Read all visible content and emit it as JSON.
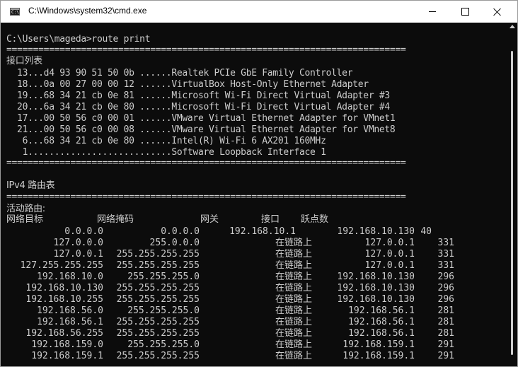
{
  "window": {
    "title": "C:\\Windows\\system32\\cmd.exe",
    "icon_label": "C:\\",
    "controls": [
      "minimize-icon",
      "maximize-icon",
      "close-icon"
    ]
  },
  "console": {
    "prompt": "C:\\Users\\mageda>route print",
    "separator": "===========================================================================",
    "interface_header": "接口列表",
    "interfaces": [
      "  13...d4 93 90 51 50 0b ......Realtek PCIe GbE Family Controller",
      "  18...0a 00 27 00 00 12 ......VirtualBox Host-Only Ethernet Adapter",
      "  19...68 34 21 cb 0e 81 ......Microsoft Wi-Fi Direct Virtual Adapter #3",
      "  20...6a 34 21 cb 0e 80 ......Microsoft Wi-Fi Direct Virtual Adapter #4",
      "  17...00 50 56 c0 00 01 ......VMware Virtual Ethernet Adapter for VMnet1",
      "  21...00 50 56 c0 00 08 ......VMware Virtual Ethernet Adapter for VMnet8",
      "   6...68 34 21 cb 0e 80 ......Intel(R) Wi-Fi 6 AX201 160MHz",
      "   1...........................Software Loopback Interface 1"
    ],
    "ipv4_header": "IPv4 路由表",
    "active_routes_label": "活动路由:",
    "columns": [
      "网络目标",
      "网络掩码",
      "网关",
      "接口",
      "跃点数"
    ],
    "routes": [
      {
        "dest": "0.0.0.0",
        "mask": "0.0.0.0",
        "gateway": "192.168.10.1",
        "iface": "192.168.10.130",
        "metric": "40"
      },
      {
        "dest": "127.0.0.0",
        "mask": "255.0.0.0",
        "gateway": "在链路上",
        "iface": "127.0.0.1",
        "metric": "331"
      },
      {
        "dest": "127.0.0.1",
        "mask": "255.255.255.255",
        "gateway": "在链路上",
        "iface": "127.0.0.1",
        "metric": "331"
      },
      {
        "dest": "127.255.255.255",
        "mask": "255.255.255.255",
        "gateway": "在链路上",
        "iface": "127.0.0.1",
        "metric": "331"
      },
      {
        "dest": "192.168.10.0",
        "mask": "255.255.255.0",
        "gateway": "在链路上",
        "iface": "192.168.10.130",
        "metric": "296"
      },
      {
        "dest": "192.168.10.130",
        "mask": "255.255.255.255",
        "gateway": "在链路上",
        "iface": "192.168.10.130",
        "metric": "296"
      },
      {
        "dest": "192.168.10.255",
        "mask": "255.255.255.255",
        "gateway": "在链路上",
        "iface": "192.168.10.130",
        "metric": "296"
      },
      {
        "dest": "192.168.56.0",
        "mask": "255.255.255.0",
        "gateway": "在链路上",
        "iface": "192.168.56.1",
        "metric": "281"
      },
      {
        "dest": "192.168.56.1",
        "mask": "255.255.255.255",
        "gateway": "在链路上",
        "iface": "192.168.56.1",
        "metric": "281"
      },
      {
        "dest": "192.168.56.255",
        "mask": "255.255.255.255",
        "gateway": "在链路上",
        "iface": "192.168.56.1",
        "metric": "281"
      },
      {
        "dest": "192.168.159.0",
        "mask": "255.255.255.0",
        "gateway": "在链路上",
        "iface": "192.168.159.1",
        "metric": "291"
      },
      {
        "dest": "192.168.159.1",
        "mask": "255.255.255.255",
        "gateway": "在链路上",
        "iface": "192.168.159.1",
        "metric": "291"
      }
    ]
  },
  "colors": {
    "console_bg": "#0c0c0c",
    "console_fg": "#cccccc",
    "titlebar_bg": "#ffffff"
  }
}
